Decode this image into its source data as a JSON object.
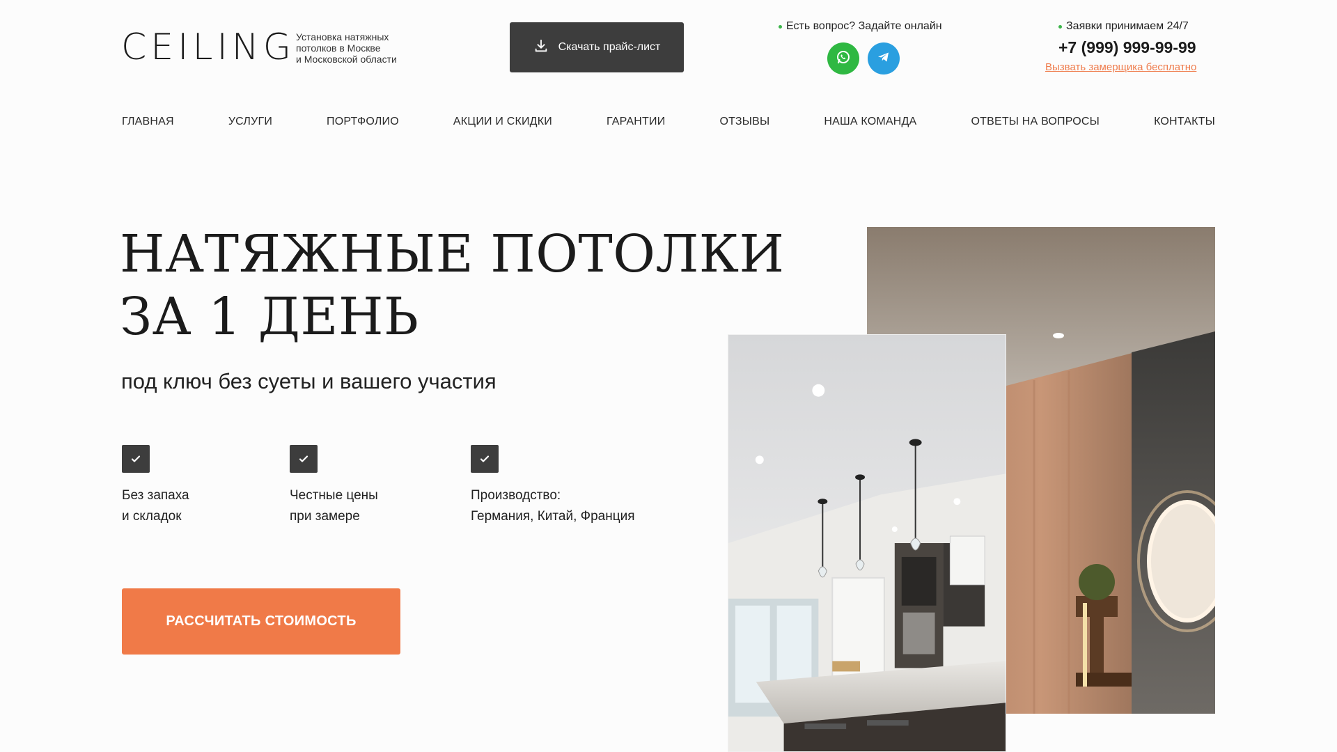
{
  "header": {
    "logo": "CEILING",
    "tagline": [
      "Установка натяжных",
      "потолков в Москве",
      "и Московской области"
    ],
    "price_button": "Скачать прайс-лист",
    "question_label": "Есть вопрос? Задайте онлайн",
    "messengers": [
      {
        "name": "WhatsApp",
        "icon": "whatsapp-icon",
        "color": "#2fb842"
      },
      {
        "name": "Telegram",
        "icon": "telegram-icon",
        "color": "#2a9fe0"
      }
    ],
    "hours_label": "Заявки принимаем 24/7",
    "phone": "+7 (999) 999-99-99",
    "callout_link": "Вызвать замерщика бесплатно"
  },
  "nav": [
    "ГЛАВНАЯ",
    "УСЛУГИ",
    "ПОРТФОЛИО",
    "АКЦИИ И СКИДКИ",
    "ГАРАНТИИ",
    "ОТЗЫВЫ",
    "НАША КОМАНДА",
    "ОТВЕТЫ НА ВОПРОСЫ",
    "КОНТАКТЫ"
  ],
  "hero": {
    "title_line1": "НАТЯЖНЫЕ ПОТОЛКИ",
    "title_line2": "ЗА 1 ДЕНЬ",
    "subtitle": "под ключ без суеты и вашего участия",
    "features": [
      {
        "line1": "Без запаха",
        "line2": "и складок"
      },
      {
        "line1": "Честные цены",
        "line2": "при замере"
      },
      {
        "line1": "Производство:",
        "line2": "Германия, Китай, Франция"
      }
    ],
    "cta": "РАССЧИТАТЬ СТОИМОСТЬ"
  },
  "colors": {
    "accent": "#f07a48",
    "dark": "#3d3d3d",
    "online_dot": "#3cb54a"
  }
}
